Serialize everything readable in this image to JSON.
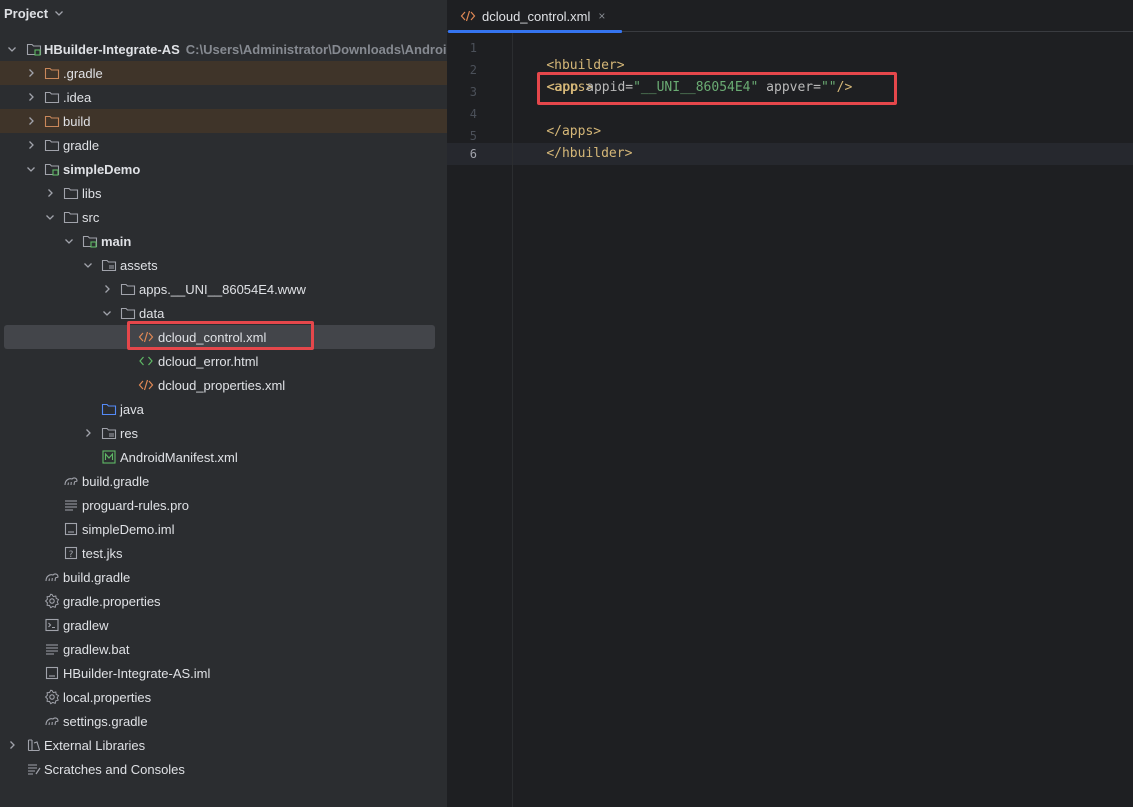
{
  "panel": {
    "title": "Project"
  },
  "tree": [
    {
      "label": "HBuilder-Integrate-AS",
      "hint": "C:\\Users\\Administrator\\Downloads\\Android-",
      "icon": "module-folder-icon",
      "bold": true
    },
    {
      "label": ".gradle",
      "icon": "folder-icon"
    },
    {
      "label": ".idea",
      "icon": "folder-icon"
    },
    {
      "label": "build",
      "icon": "folder-icon"
    },
    {
      "label": "gradle",
      "icon": "folder-icon"
    },
    {
      "label": "simpleDemo",
      "icon": "module-folder-icon",
      "bold": true
    },
    {
      "label": "libs",
      "icon": "folder-icon"
    },
    {
      "label": "src",
      "icon": "folder-icon"
    },
    {
      "label": "main",
      "icon": "source-folder-icon",
      "bold": true
    },
    {
      "label": "assets",
      "icon": "resource-folder-icon"
    },
    {
      "label": "apps.__UNI__86054E4.www",
      "icon": "folder-icon"
    },
    {
      "label": "data",
      "icon": "folder-icon"
    },
    {
      "label": "dcloud_control.xml",
      "icon": "xml-file-icon"
    },
    {
      "label": "dcloud_error.html",
      "icon": "html-file-icon"
    },
    {
      "label": "dcloud_properties.xml",
      "icon": "xml-file-icon"
    },
    {
      "label": "java",
      "icon": "java-folder-icon"
    },
    {
      "label": "res",
      "icon": "resource-folder-icon"
    },
    {
      "label": "AndroidManifest.xml",
      "icon": "manifest-file-icon"
    },
    {
      "label": "build.gradle",
      "icon": "gradle-file-icon"
    },
    {
      "label": "proguard-rules.pro",
      "icon": "text-file-icon"
    },
    {
      "label": "simpleDemo.iml",
      "icon": "iml-file-icon"
    },
    {
      "label": "test.jks",
      "icon": "unknown-file-icon"
    },
    {
      "label": "build.gradle",
      "icon": "gradle-file-icon"
    },
    {
      "label": "gradle.properties",
      "icon": "settings-file-icon"
    },
    {
      "label": "gradlew",
      "icon": "terminal-file-icon"
    },
    {
      "label": "gradlew.bat",
      "icon": "text-file-icon"
    },
    {
      "label": "HBuilder-Integrate-AS.iml",
      "icon": "iml-file-icon"
    },
    {
      "label": "local.properties",
      "icon": "settings-file-icon"
    },
    {
      "label": "settings.gradle",
      "icon": "gradle-file-icon"
    },
    {
      "label": "External Libraries",
      "icon": "library-icon"
    },
    {
      "label": "Scratches and Consoles",
      "icon": "scratches-icon"
    }
  ],
  "editor": {
    "tab": {
      "label": "dcloud_control.xml",
      "close": "×"
    },
    "line_numbers": [
      "1",
      "2",
      "3",
      "4",
      "5",
      "6"
    ],
    "code": {
      "l1": "<hbuilder>",
      "l2": "<apps>",
      "l3_open": "<app",
      "l3_attr1": " appid=",
      "l3_val1": "\"__UNI__86054E4\"",
      "l3_attr2": " appver=",
      "l3_val2": "\"\"",
      "l3_close": "/>",
      "l4": "</apps>",
      "l5": "</hbuilder>"
    }
  },
  "colors": {
    "accent": "#3574f0",
    "highlight_box": "#e5474b",
    "xml_tag": "#d5b778",
    "xml_value": "#6aab73"
  }
}
